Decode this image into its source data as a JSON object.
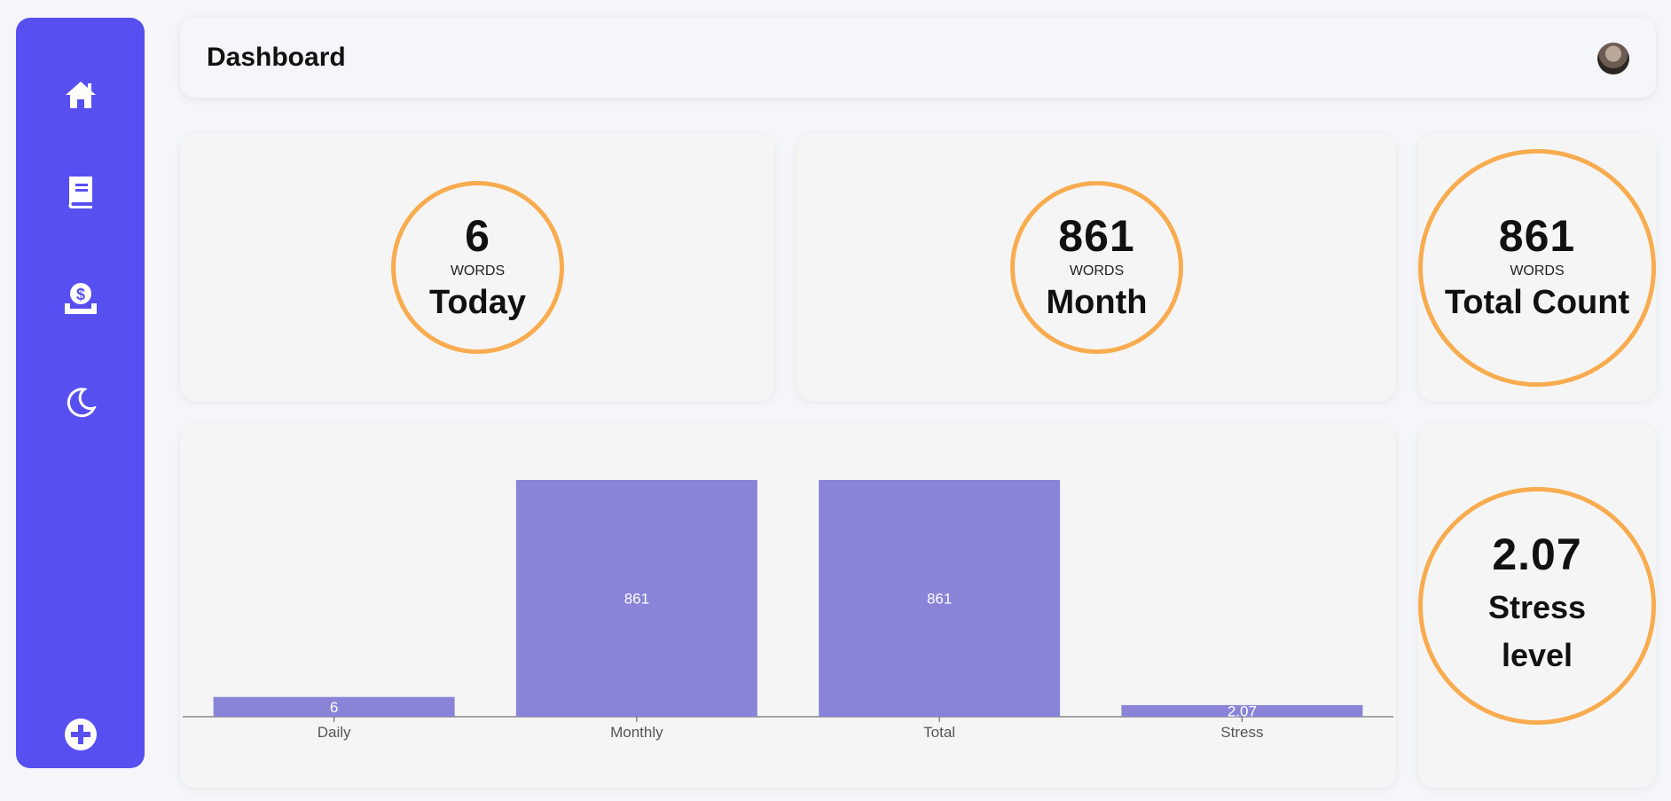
{
  "sidebar": {
    "accent": "#584ff1",
    "items": [
      {
        "icon": "home-icon"
      },
      {
        "icon": "book-icon"
      },
      {
        "icon": "money-icon"
      },
      {
        "icon": "moon-icon"
      },
      {
        "icon": "add-icon"
      }
    ]
  },
  "header": {
    "title": "Dashboard"
  },
  "stats": {
    "today": {
      "value": "6",
      "unit": "WORDS",
      "label": "Today"
    },
    "month": {
      "value": "861",
      "unit": "WORDS",
      "label": "Month"
    },
    "total": {
      "value": "861",
      "unit": "WORDS",
      "label": "Total Count"
    },
    "stress": {
      "value": "2.07",
      "label_line1": "Stress",
      "label_line2": "level"
    }
  },
  "colors": {
    "ring": "#f8ac4f",
    "bar": "#8a84d8"
  },
  "chart_data": {
    "type": "bar",
    "categories": [
      "Daily",
      "Monthly",
      "Total",
      "Stress"
    ],
    "values": [
      6,
      861,
      861,
      2.07
    ],
    "value_labels": [
      "6",
      "861",
      "861",
      "2.07"
    ],
    "title": "",
    "xlabel": "",
    "ylabel": "",
    "grid": false
  }
}
